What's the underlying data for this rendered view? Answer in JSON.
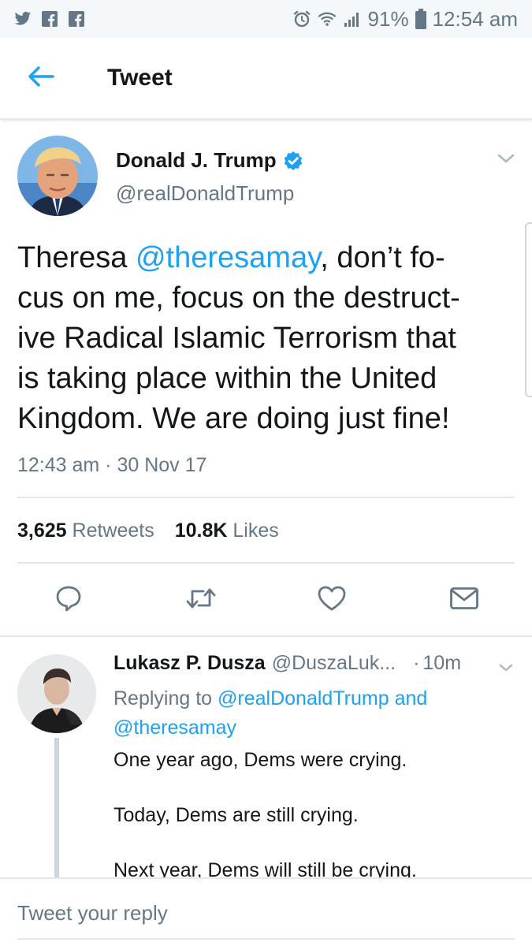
{
  "status_bar": {
    "battery_percent": "91%",
    "time": "12:54 am",
    "left_icons": [
      "twitter-icon",
      "facebook-icon",
      "facebook-icon"
    ],
    "right_icons": [
      "alarm-icon",
      "wifi-icon",
      "signal-icon",
      "battery-icon"
    ]
  },
  "header": {
    "title": "Tweet",
    "back_icon": "arrow-left-icon"
  },
  "tweet": {
    "author_name": "Donald J. Trump",
    "author_handle": "@realDonaldTrump",
    "verified": true,
    "text_lines": [
      {
        "before": "Theresa ",
        "mention": "@theresamay",
        "after": ", don’t fo-"
      },
      {
        "text": "cus on me, focus on the destruct-"
      },
      {
        "text": "ive Radical Islamic Terrorism that"
      },
      {
        "text": "is taking place within the United"
      },
      {
        "text": "Kingdom. We are doing just fine!"
      }
    ],
    "timestamp": "12:43 am · 30 Nov 17",
    "retweets_count": "3,625",
    "retweets_label": "Retweets",
    "likes_count": "10.8K",
    "likes_label": "Likes",
    "actions": [
      "reply-icon",
      "retweet-icon",
      "like-icon",
      "share-icon"
    ]
  },
  "reply": {
    "name": "Lukasz P. Dusza",
    "handle": "@DuszaLuk...",
    "separator": "·",
    "time": "10m",
    "replying_prefix": "Replying to",
    "replying_user1": "@realDonaldTrump",
    "replying_and": "and",
    "replying_user2": "@theresamay",
    "body": [
      "One year ago, Dems were crying.",
      "Today, Dems are still crying.",
      "Next year, Dems will still be crying."
    ]
  },
  "reply_bar": {
    "placeholder": "Tweet your reply"
  },
  "colors": {
    "accent": "#1da1f2",
    "text": "#14171a",
    "secondary": "#657786",
    "divider": "#e1e8ed"
  }
}
